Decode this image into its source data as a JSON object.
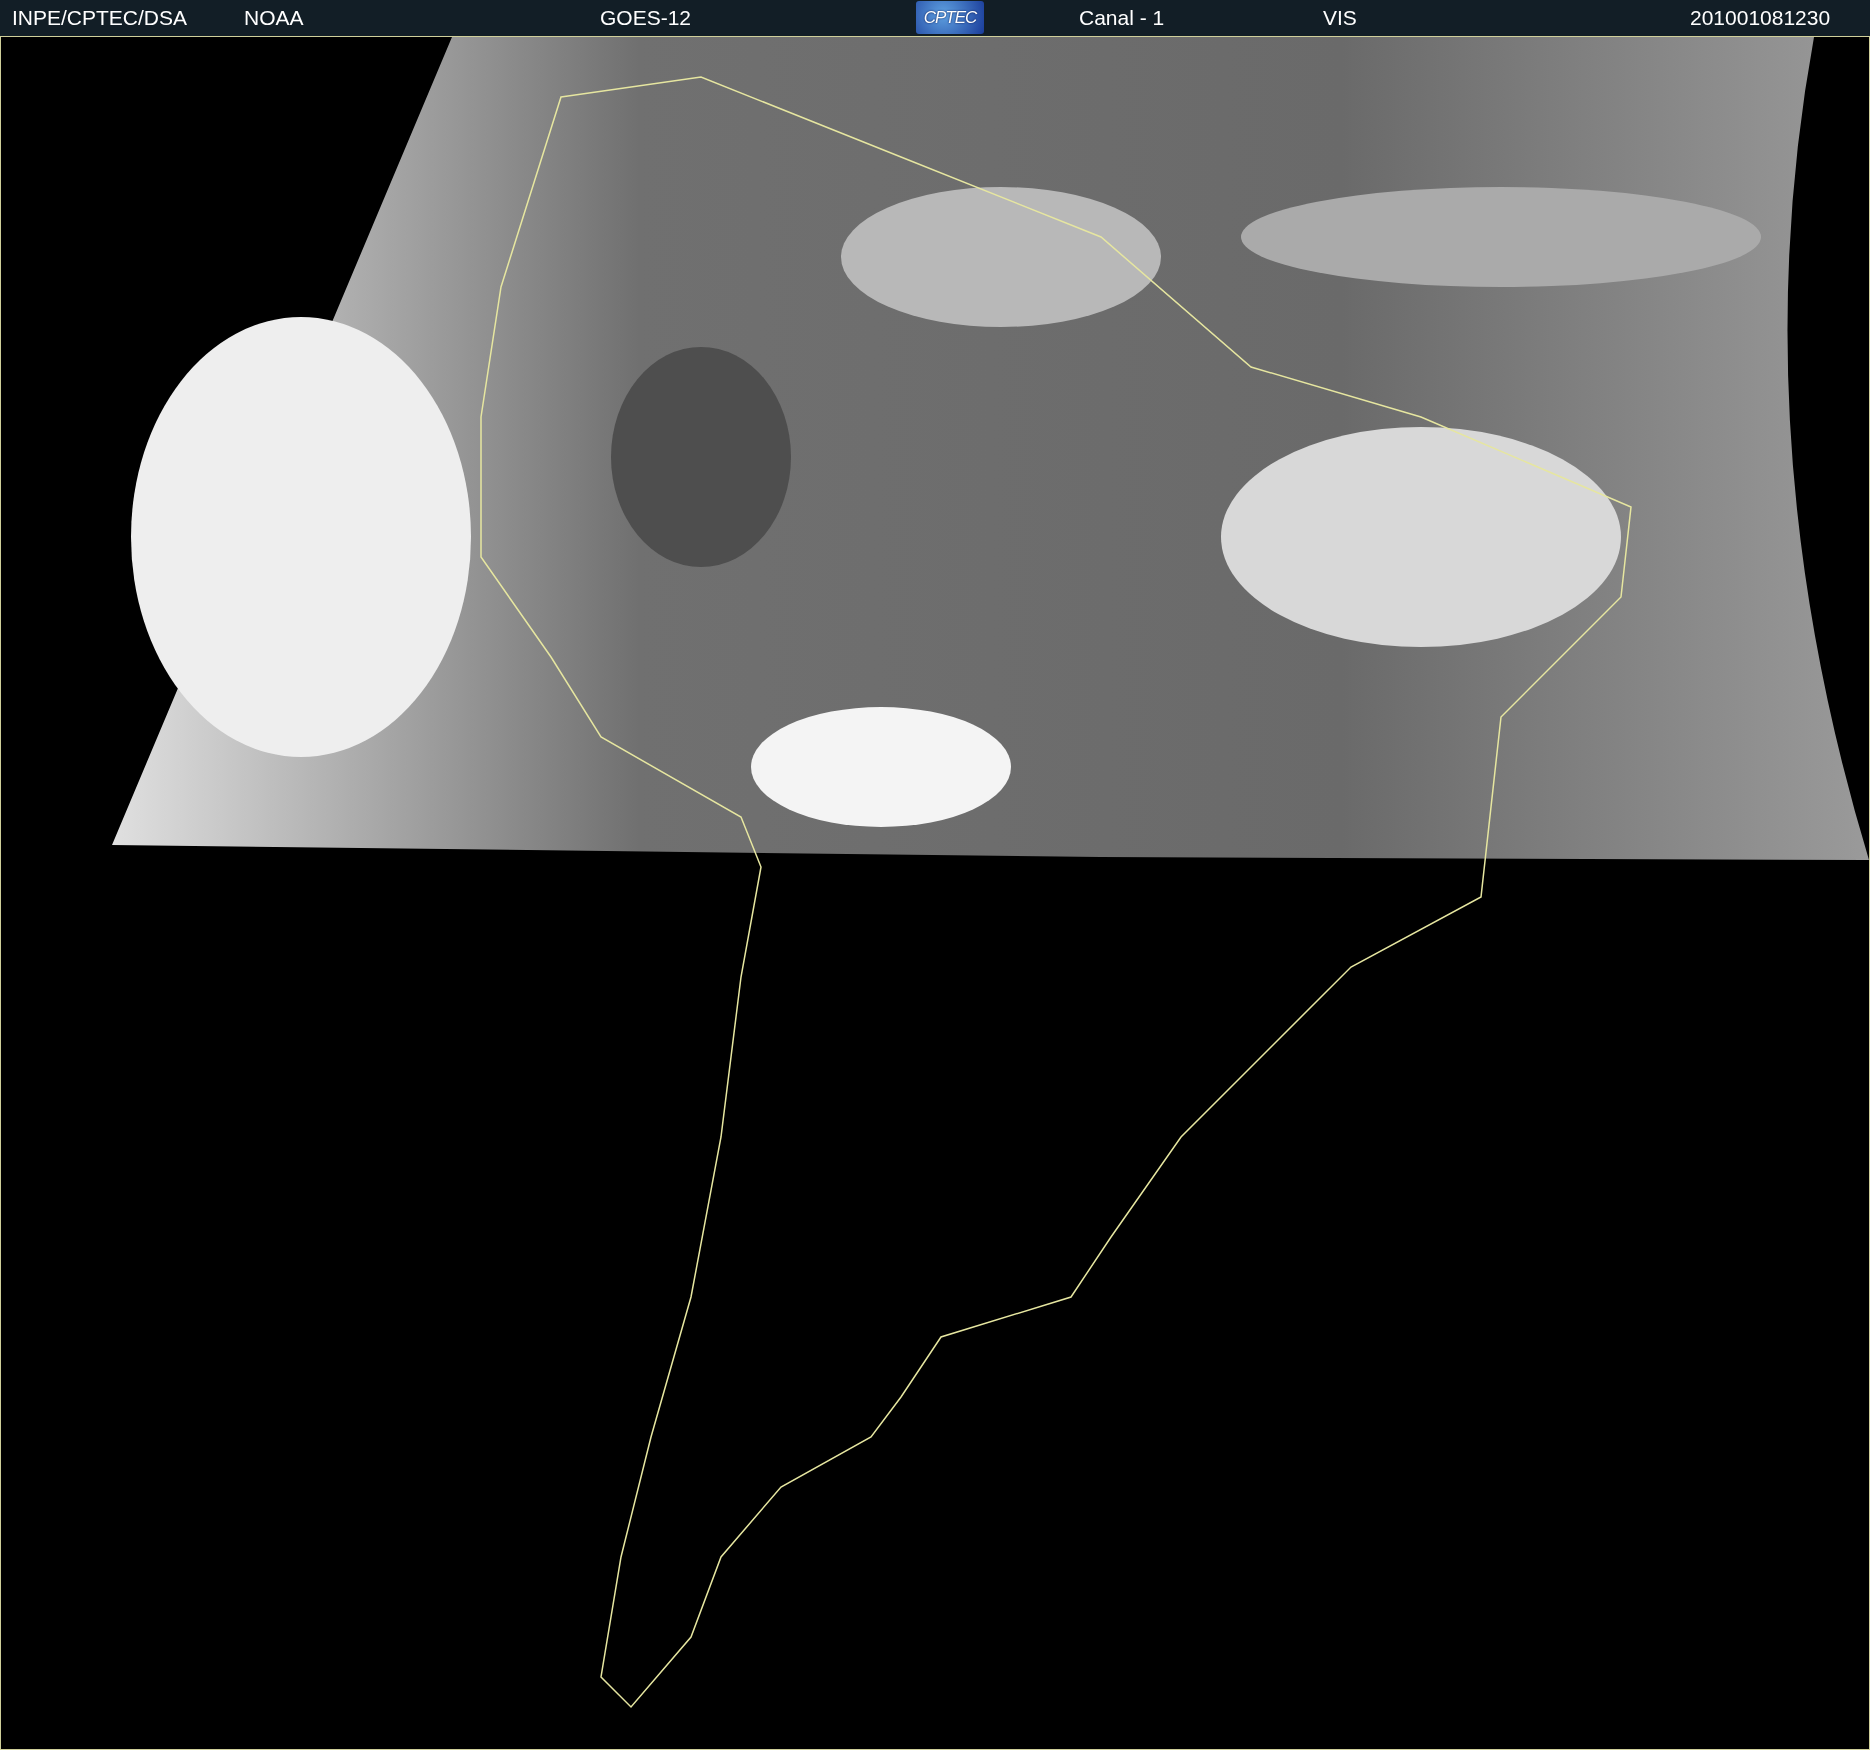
{
  "header": {
    "labels": [
      {
        "kind": "text",
        "text": "INPE/CPTEC/DSA"
      },
      {
        "kind": "text",
        "text": "NOAA"
      },
      {
        "kind": "text",
        "text": "GOES-12"
      },
      {
        "kind": "logo",
        "text": "CPTEC"
      },
      {
        "kind": "text",
        "text": "Canal - 1"
      },
      {
        "kind": "text",
        "text": "VIS"
      },
      {
        "kind": "text",
        "text": "201001081230"
      }
    ]
  }
}
